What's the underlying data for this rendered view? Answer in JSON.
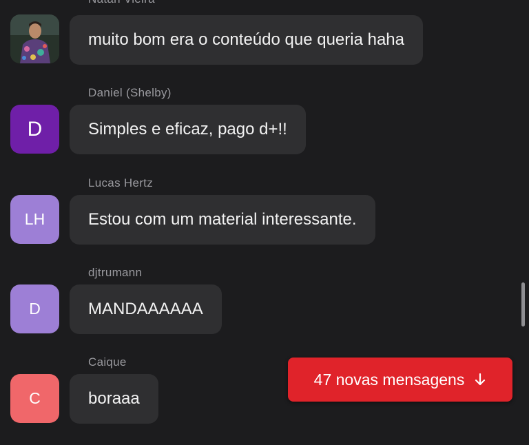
{
  "messages": [
    {
      "sender": "Natan Vieira",
      "avatar_initials": "",
      "avatar_color": "#3a4a3a",
      "text": "muito bom era o conteúdo que queria haha"
    },
    {
      "sender": "Daniel (Shelby)",
      "avatar_initials": "D",
      "avatar_color": "#6f1fa8",
      "text": "Simples e eficaz, pago d+!!"
    },
    {
      "sender": "Lucas Hertz",
      "avatar_initials": "LH",
      "avatar_color": "#9d7fd6",
      "text": "Estou com um material interessante."
    },
    {
      "sender": "djtrumann",
      "avatar_initials": "D",
      "avatar_color": "#9d7fd6",
      "text": "MANDAAAAAA"
    },
    {
      "sender": "Caique",
      "avatar_initials": "C",
      "avatar_color": "#f0676a",
      "text": "boraaa"
    }
  ],
  "new_messages_button": {
    "label": "47 novas mensagens",
    "icon": "arrow-down-icon",
    "color": "#e0232a"
  }
}
